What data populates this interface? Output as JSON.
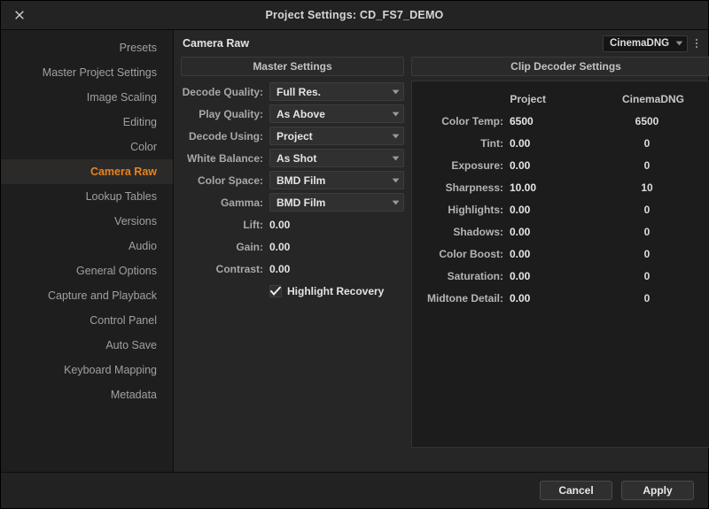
{
  "window": {
    "title_prefix": "Project Settings:",
    "project_name": "CD_FS7_DEMO",
    "title": "Project Settings:  CD_FS7_DEMO",
    "close_icon": "close-x-icon"
  },
  "colors": {
    "accent": "#e8821e",
    "window_bg": "#1e1e1e",
    "panel_bg": "#262626",
    "footer_bg": "#222222"
  },
  "sidebar": {
    "items": [
      {
        "label": "Presets",
        "active": false
      },
      {
        "label": "Master Project Settings",
        "active": false
      },
      {
        "label": "Image Scaling",
        "active": false
      },
      {
        "label": "Editing",
        "active": false
      },
      {
        "label": "Color",
        "active": false
      },
      {
        "label": "Camera Raw",
        "active": true
      },
      {
        "label": "Lookup Tables",
        "active": false
      },
      {
        "label": "Versions",
        "active": false
      },
      {
        "label": "Audio",
        "active": false
      },
      {
        "label": "General Options",
        "active": false
      },
      {
        "label": "Capture and Playback",
        "active": false
      },
      {
        "label": "Control Panel",
        "active": false
      },
      {
        "label": "Auto Save",
        "active": false
      },
      {
        "label": "Keyboard Mapping",
        "active": false
      },
      {
        "label": "Metadata",
        "active": false
      }
    ]
  },
  "panel": {
    "title": "Camera Raw",
    "preset_selected": "CinemaDNG",
    "preset_chevron_icon": "chevron-down-icon",
    "options_menu_icon": "vertical-dots-icon"
  },
  "master_settings": {
    "header": "Master Settings",
    "dropdowns": [
      {
        "label": "Decode Quality:",
        "value": "Full Res."
      },
      {
        "label": "Play Quality:",
        "value": "As Above"
      },
      {
        "label": "Decode Using:",
        "value": "Project"
      },
      {
        "label": "White Balance:",
        "value": "As Shot"
      },
      {
        "label": "Color Space:",
        "value": "BMD Film"
      },
      {
        "label": "Gamma:",
        "value": "BMD Film"
      }
    ],
    "numbers": [
      {
        "label": "Lift:",
        "value": "0.00"
      },
      {
        "label": "Gain:",
        "value": "0.00"
      },
      {
        "label": "Contrast:",
        "value": "0.00"
      }
    ],
    "checkbox": {
      "label": "Highlight Recovery",
      "checked": true,
      "icon": "checkmark-icon"
    }
  },
  "clip_decoder_settings": {
    "header": "Clip Decoder Settings",
    "column_headers": {
      "project": "Project",
      "clip": "CinemaDNG"
    },
    "rows": [
      {
        "label": "Color Temp:",
        "project": "6500",
        "clip": "6500"
      },
      {
        "label": "Tint:",
        "project": "0.00",
        "clip": "0"
      },
      {
        "label": "Exposure:",
        "project": "0.00",
        "clip": "0"
      },
      {
        "label": "Sharpness:",
        "project": "10.00",
        "clip": "10"
      },
      {
        "label": "Highlights:",
        "project": "0.00",
        "clip": "0"
      },
      {
        "label": "Shadows:",
        "project": "0.00",
        "clip": "0"
      },
      {
        "label": "Color Boost:",
        "project": "0.00",
        "clip": "0"
      },
      {
        "label": "Saturation:",
        "project": "0.00",
        "clip": "0"
      },
      {
        "label": "Midtone Detail:",
        "project": "0.00",
        "clip": "0"
      }
    ]
  },
  "footer": {
    "cancel_label": "Cancel",
    "apply_label": "Apply"
  }
}
